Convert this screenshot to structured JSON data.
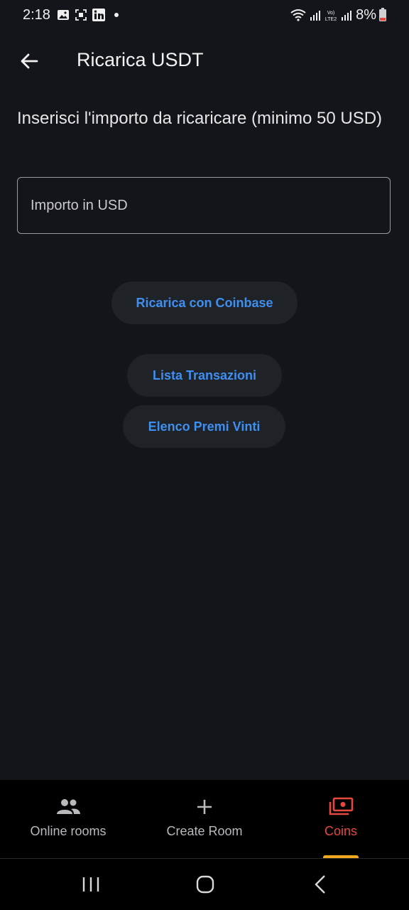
{
  "status_bar": {
    "time": "2:18",
    "battery": "8%",
    "icons": [
      "image-icon",
      "screenshot-icon",
      "linkedin-icon",
      "dot-icon",
      "wifi-icon",
      "signal-icon",
      "volte-lte2-icon",
      "signal-icon",
      "battery-icon"
    ]
  },
  "app_bar": {
    "title": "Ricarica USDT",
    "back_icon": "arrow-left-icon"
  },
  "main": {
    "instruction": "Inserisci l'importo da ricaricare (minimo 50 USD)",
    "amount_placeholder": "Importo in USD",
    "amount_value": "",
    "buttons": {
      "coinbase": "Ricarica con Coinbase",
      "transactions": "Lista Transazioni",
      "prizes": "Elenco Premi Vinti"
    },
    "accent_color": "#3f8ff0"
  },
  "bottom_nav": {
    "items": [
      {
        "label": "Online rooms",
        "icon": "people-icon",
        "active": false
      },
      {
        "label": "Create Room",
        "icon": "plus-icon",
        "active": false
      },
      {
        "label": "Coins",
        "icon": "coins-icon",
        "active": true
      }
    ],
    "active_color": "#e6473f",
    "inactive_color": "#b8b8bd",
    "indicator_color": "#f2a81d"
  },
  "system_nav": {
    "buttons": [
      "recent-apps-icon",
      "home-icon",
      "back-icon"
    ]
  }
}
